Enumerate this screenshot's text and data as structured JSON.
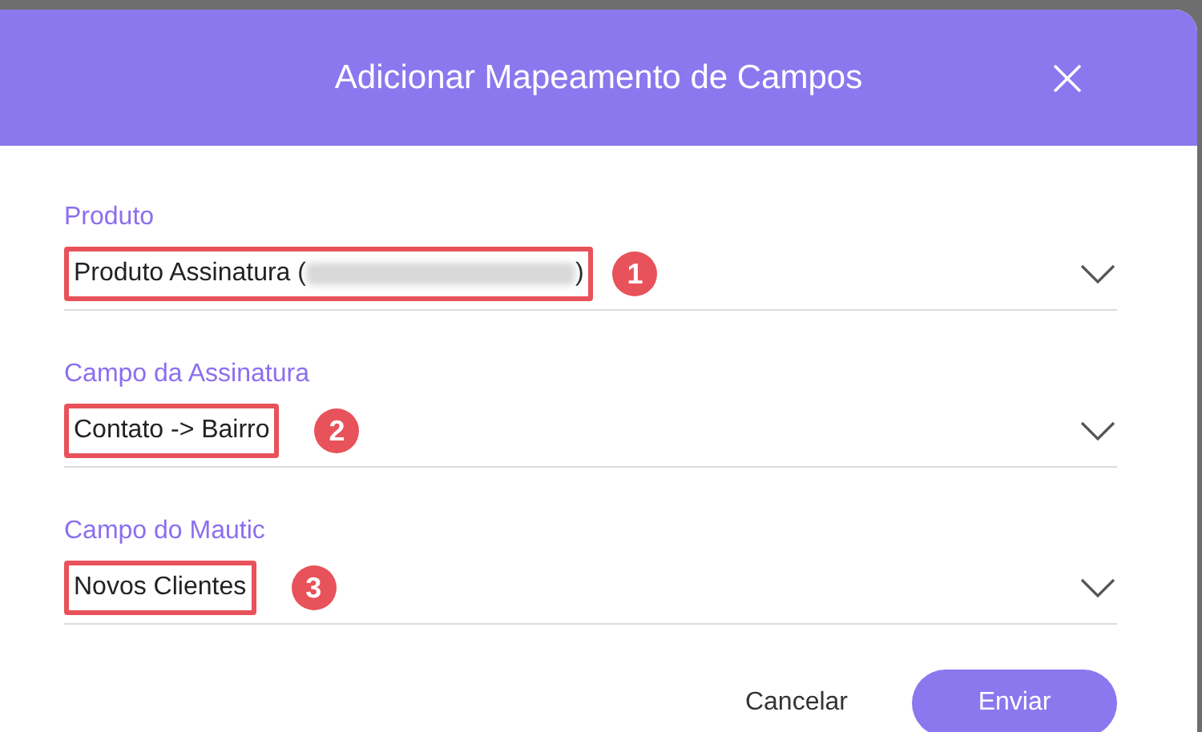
{
  "dialog": {
    "title": "Adicionar Mapeamento de Campos"
  },
  "fields": [
    {
      "label": "Produto",
      "value": "Produto Assinatura (",
      "redacted": true,
      "value_end": ")",
      "marker": "1"
    },
    {
      "label": "Campo da Assinatura",
      "value": "Contato -> Bairro",
      "redacted": false,
      "marker": "2"
    },
    {
      "label": "Campo do Mautic",
      "value": "Novos Clientes",
      "redacted": false,
      "marker": "3"
    }
  ],
  "buttons": {
    "cancel": "Cancelar",
    "submit": "Enviar"
  }
}
